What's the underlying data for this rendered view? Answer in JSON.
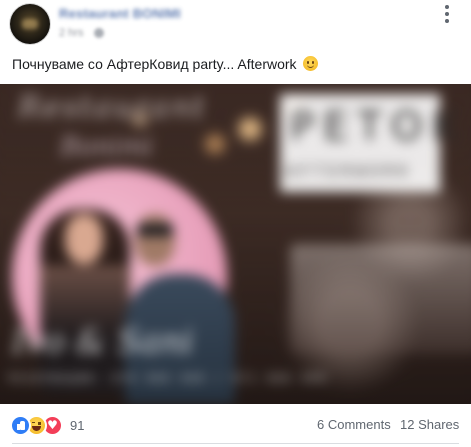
{
  "post": {
    "page_name": "Restaurant BONIMI",
    "time": "2 hrs",
    "text": "Почнуваме со АфтерКовид party... Afterwork",
    "emoji": "smile-emoji"
  },
  "image": {
    "brand_line_1": "Restaurant",
    "brand_line_2": "Bonimi",
    "headline": "PETOK",
    "subheadline": "AFTERWORK",
    "performers": "Ivo & Sani",
    "phones": "РЕЗЕРВАЦИИ: 070 000 000 / 071 000 000"
  },
  "footer": {
    "reactions": [
      "like-icon",
      "haha-icon",
      "love-icon"
    ],
    "reaction_count": "91",
    "comments": "6 Comments",
    "shares": "12 Shares"
  },
  "colors": {
    "text": "#1c1e21",
    "meta": "#606770",
    "like": "#2f7df6",
    "love": "#f33e58"
  }
}
